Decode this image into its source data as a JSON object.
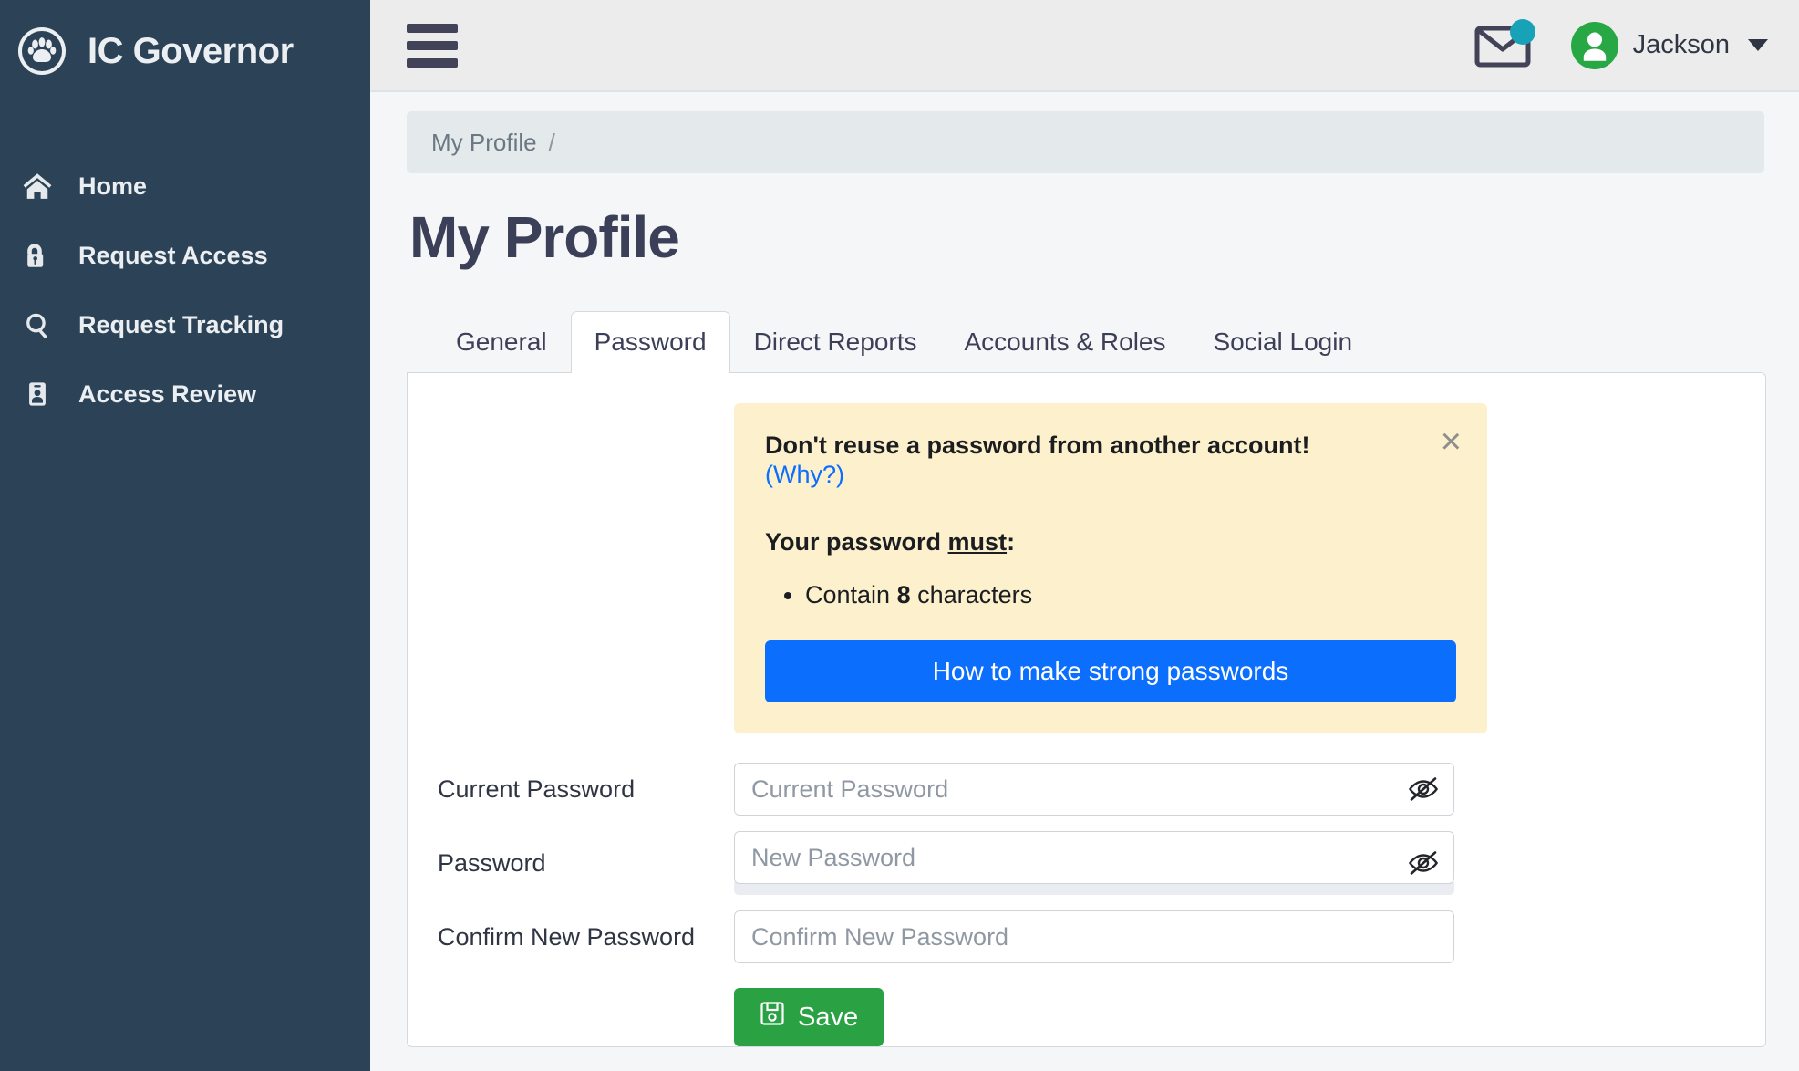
{
  "brand": {
    "title": "IC Governor",
    "logo_icon": "paw-circle-icon"
  },
  "sidebar": {
    "items": [
      {
        "label": "Home",
        "icon": "home-icon"
      },
      {
        "label": "Request Access",
        "icon": "unlock-icon"
      },
      {
        "label": "Request Tracking",
        "icon": "search-icon"
      },
      {
        "label": "Access Review",
        "icon": "id-badge-icon"
      }
    ]
  },
  "topbar": {
    "menu_icon": "hamburger-icon",
    "mail_icon": "envelope-icon",
    "mail_badge": "",
    "avatar_icon": "user-avatar-icon",
    "user_name": "Jackson",
    "caret_icon": "chevron-down-icon"
  },
  "breadcrumb": {
    "item": "My Profile",
    "separator": "/"
  },
  "page": {
    "title": "My Profile"
  },
  "tabs": [
    {
      "label": "General",
      "active": false
    },
    {
      "label": "Password",
      "active": true
    },
    {
      "label": "Direct Reports",
      "active": false
    },
    {
      "label": "Accounts & Roles",
      "active": false
    },
    {
      "label": "Social Login",
      "active": false
    }
  ],
  "alert": {
    "heading": "Don't reuse a password from another account!",
    "why_link": "(Why?)",
    "close_icon": "close-icon",
    "close_glyph": "×",
    "sub_prefix": "Your password ",
    "sub_underlined": "must",
    "sub_suffix": ":",
    "requirements": [
      {
        "prefix": "Contain ",
        "value": "8",
        "suffix": " characters"
      }
    ],
    "button_label": "How to make strong passwords"
  },
  "form": {
    "fields": [
      {
        "label": "Current Password",
        "placeholder": "Current Password",
        "value": "",
        "has_eye": true,
        "eye_icon": "eye-slash-icon",
        "has_meter": false
      },
      {
        "label": "Password",
        "placeholder": "New Password",
        "value": "",
        "has_eye": true,
        "eye_icon": "eye-slash-icon",
        "has_meter": true
      },
      {
        "label": "Confirm New Password",
        "placeholder": "Confirm New Password",
        "value": "",
        "has_eye": false,
        "eye_icon": "",
        "has_meter": false
      }
    ],
    "save_label": "Save",
    "save_icon": "floppy-disk-icon"
  },
  "colors": {
    "sidebar_bg": "#2b4257",
    "topbar_bg": "#ececec",
    "page_bg": "#f5f6f7",
    "accent_blue": "#0b6efd",
    "alert_bg": "#fdf0cd",
    "save_green": "#2aa244",
    "avatar_green": "#28a745",
    "mail_badge": "#17a2b8"
  }
}
